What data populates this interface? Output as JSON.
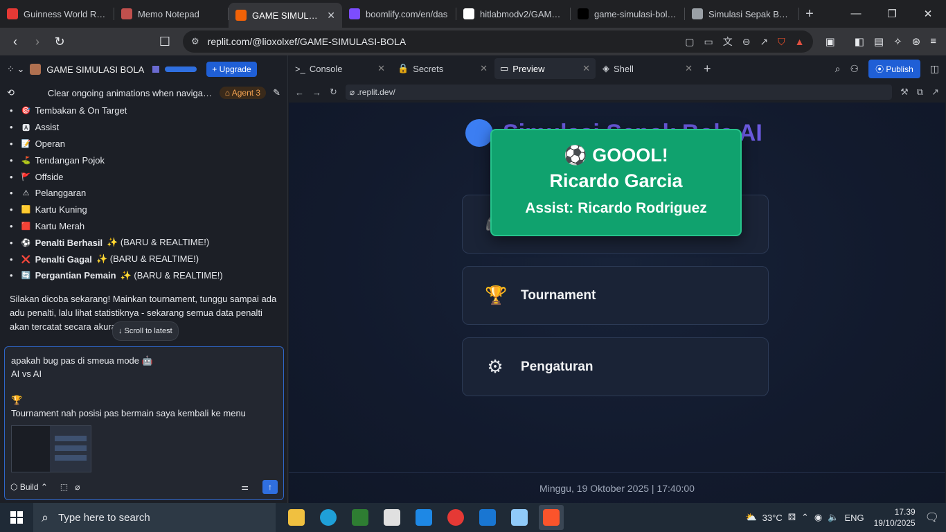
{
  "browser": {
    "tabs": [
      {
        "title": "Guinness World Reco",
        "color": "#e53935",
        "active": false
      },
      {
        "title": "Memo Notepad",
        "color": "#c0504d",
        "active": false
      },
      {
        "title": "GAME SIMULASI",
        "color": "#f26207",
        "active": true
      },
      {
        "title": "boomlify.com/en/das",
        "color": "#7c4dff",
        "active": false
      },
      {
        "title": "hitlabmodv2/GAME_S",
        "color": "#ffffff",
        "active": false
      },
      {
        "title": "game-simulasi-bola -",
        "color": "#000000",
        "active": false
      },
      {
        "title": "Simulasi Sepak Bola A",
        "color": "#9aa0a6",
        "active": false
      }
    ],
    "url": "replit.com/@lioxolxef/GAME-SIMULASI-BOLA"
  },
  "left": {
    "project": "GAME SIMULASI BOLA",
    "upgrade": "Upgrade",
    "message_title": "Clear ongoing animations when navigatin...",
    "agent": "Agent 3",
    "list": [
      {
        "icon": "🎯",
        "text": "Tembakan & On Target",
        "bold": "",
        "extra": ""
      },
      {
        "icon": "🅰",
        "text": "Assist",
        "bold": "",
        "extra": ""
      },
      {
        "icon": "📝",
        "text": "Operan",
        "bold": "",
        "extra": ""
      },
      {
        "icon": "⛳",
        "text": "Tendangan Pojok",
        "bold": "",
        "extra": ""
      },
      {
        "icon": "🚩",
        "text": "Offside",
        "bold": "",
        "extra": ""
      },
      {
        "icon": "⚠",
        "text": "Pelanggaran",
        "bold": "",
        "extra": ""
      },
      {
        "icon": "🟨",
        "text": "Kartu Kuning",
        "bold": "",
        "extra": ""
      },
      {
        "icon": "🟥",
        "text": "Kartu Merah",
        "bold": "",
        "extra": ""
      },
      {
        "icon": "⚽",
        "text": "",
        "bold": "Penalti Berhasil",
        "extra": "✨ (BARU & REALTIME!)"
      },
      {
        "icon": "❌",
        "text": "",
        "bold": "Penalti Gagal",
        "extra": "✨ (BARU & REALTIME!)"
      },
      {
        "icon": "🔄",
        "text": "",
        "bold": "Pergantian Pemain",
        "extra": "✨ (BARU & REALTIME!)"
      }
    ],
    "paragraph": "Silakan dicoba sekarang! Mainkan tournament, tunggu sampai ada adu penalti, lalu lihat statistiknya - sekarang semua data penalti akan tercatat secara akurat! 🎉 ⚽",
    "scroll_latest": "↓ Scroll to latest",
    "input_lines": [
      "apakah bug pas di smeua mode 🤖",
      "AI vs AI",
      "",
      "🏆",
      "Tournament nah posisi pas bermain saya kembali ke menu"
    ],
    "mode": "Build"
  },
  "right": {
    "tabs": [
      {
        "icon": ">_",
        "label": "Console",
        "active": false
      },
      {
        "icon": "🔒",
        "label": "Secrets",
        "active": false
      },
      {
        "icon": "▭",
        "label": "Preview",
        "active": true
      },
      {
        "icon": "◈",
        "label": "Shell",
        "active": false
      }
    ],
    "publish": "Publish",
    "preview_url": ".replit.dev/"
  },
  "game": {
    "title": "Simulasi Sepak Bola AI",
    "menu": [
      {
        "icon": "🎮",
        "label": ""
      },
      {
        "icon": "🏆",
        "label": "Tournament"
      },
      {
        "icon": "⚙",
        "label": "Pengaturan"
      }
    ],
    "goal_popup": {
      "line1": "⚽ GOOOL!",
      "line2": "Ricardo Garcia",
      "line3": "Assist: Ricardo Rodriguez"
    },
    "footer": "Minggu, 19 Oktober 2025 | 17:40:00"
  },
  "taskbar": {
    "search_placeholder": "Type here to search",
    "temperature": "33°C",
    "language": "ENG",
    "time": "17.39",
    "date": "19/10/2025"
  }
}
